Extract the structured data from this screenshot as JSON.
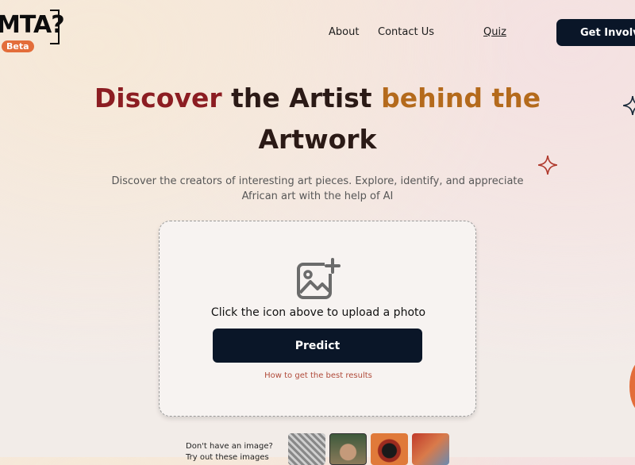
{
  "brand": {
    "logo_text": "MTA?",
    "badge": "Beta"
  },
  "nav": {
    "about": "About",
    "contact": "Contact Us",
    "quiz": "Quiz",
    "cta": "Get Involved"
  },
  "hero": {
    "title_part1": "Discover",
    "title_part2": "the Artist",
    "title_part3": "behind the",
    "title_line2": "Artwork",
    "subtitle": "Discover the creators of interesting art pieces. Explore, identify, and appreciate African art with the help of AI"
  },
  "upload": {
    "instruction": "Click the icon above to upload a photo",
    "predict_label": "Predict",
    "tips_link": "How to get the best results"
  },
  "samples": {
    "prompt": "Don't have an image?",
    "prompt_line2": "Try out these images"
  },
  "colors": {
    "dark": "#0a1628",
    "maroon": "#8c1d22",
    "ochre": "#b46a1c",
    "accent": "#e36d3a"
  },
  "icons": [
    "image-plus-icon",
    "sparkle-icon"
  ]
}
